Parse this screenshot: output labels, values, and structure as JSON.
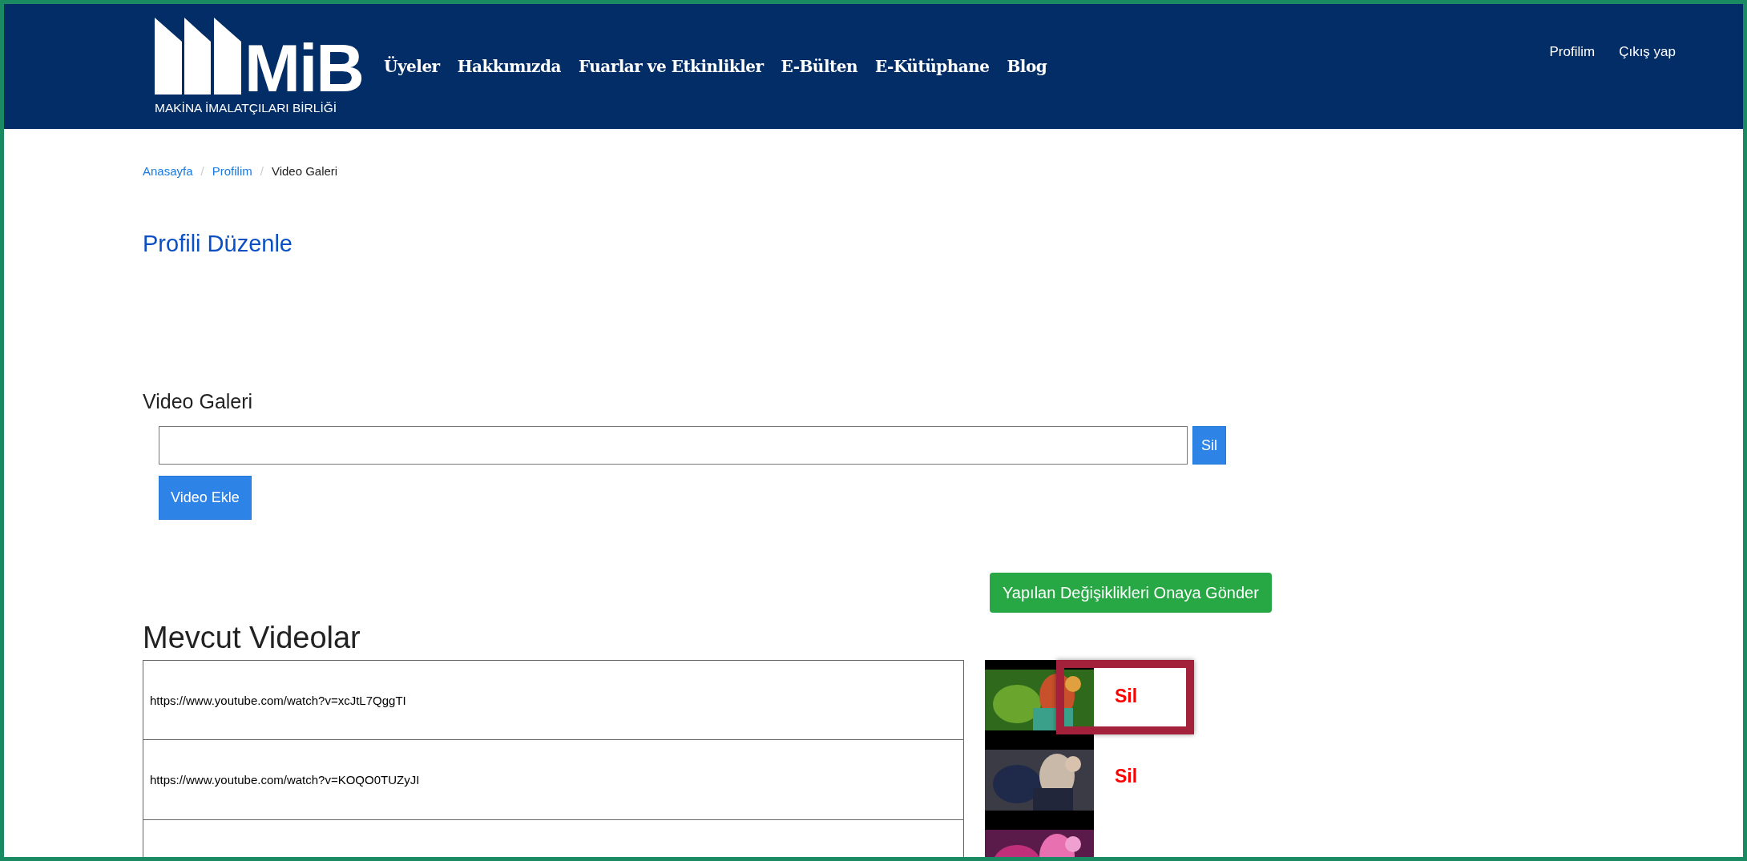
{
  "header": {
    "logo": {
      "mark": "MiB",
      "subtitle": "MAKİNA İMALATÇILARI BİRLİĞİ"
    },
    "nav": [
      "Üyeler",
      "Hakkımızda",
      "Fuarlar ve Etkinlikler",
      "E-Bülten",
      "E-Kütüphane",
      "Blog"
    ],
    "user_links": [
      "Profilim",
      "Çıkış yap"
    ]
  },
  "breadcrumb": [
    {
      "label": "Anasayfa",
      "kind": "link"
    },
    {
      "separator": "/",
      "label": "Profilim",
      "kind": "link"
    },
    {
      "separator": "/",
      "label": "Video Galeri",
      "kind": "current"
    }
  ],
  "page_title": "Profili Düzenle",
  "gallery": {
    "heading": "Video Galeri",
    "remove_button": "Sil",
    "add_button": "Video Ekle"
  },
  "submit_button": "Yapılan Değişiklikleri Onaya Gönder",
  "videos": {
    "heading": "Mevcut Videolar",
    "rows": [
      {
        "url": "https://www.youtube.com/watch?v=xcJtL7QggTI",
        "delete": "Sil",
        "highlighted": true
      },
      {
        "url": "https://www.youtube.com/watch?v=KOQO0TUZyJI",
        "delete": "Sil",
        "highlighted": false
      },
      {
        "highlighted": false
      }
    ]
  }
}
